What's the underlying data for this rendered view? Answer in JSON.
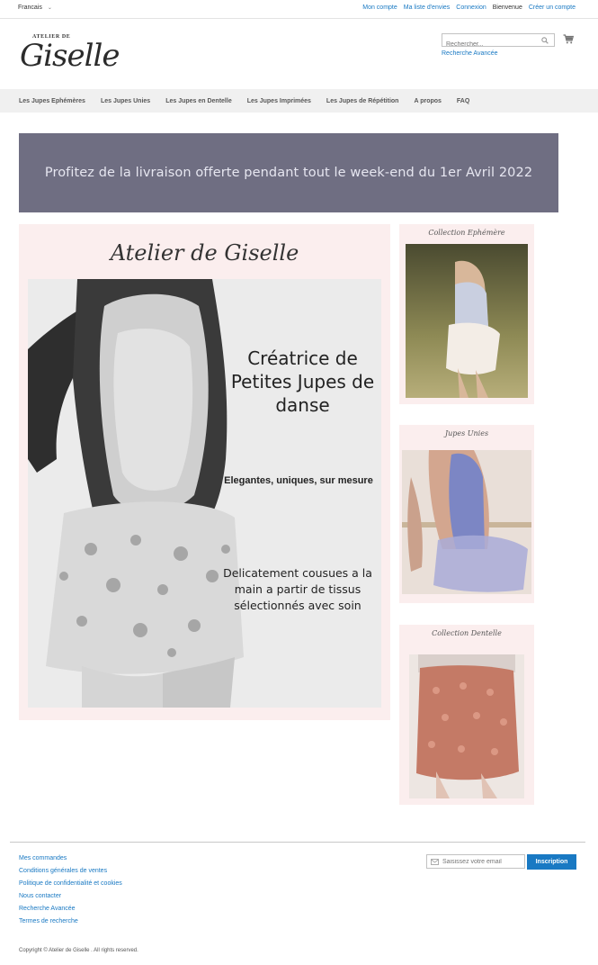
{
  "topbar": {
    "language": "Francais",
    "links": [
      "Mon compte",
      "Ma liste d'envies",
      "Connexion"
    ],
    "welcome": "Bienvenue",
    "create_account": "Créer un compte"
  },
  "header": {
    "logo_small": "ATELIER DE",
    "logo_big": "Giselle",
    "search_placeholder": "Rechercher...",
    "advanced_search": "Recherche Avancée"
  },
  "nav": {
    "items": [
      "Les Jupes Ephémères",
      "Les Jupes Unies",
      "Les Jupes en Dentelle",
      "Les Jupes Imprimées",
      "Les Jupes de Répétition",
      "A propos",
      "FAQ"
    ]
  },
  "banner": {
    "text": "Profitez de la livraison offerte pendant tout le week-end du 1er Avril 2022"
  },
  "hero": {
    "title": "Atelier de Giselle",
    "headline": "Créatrice de Petites Jupes de danse",
    "tagline": "Elegantes, uniques, sur mesure",
    "description": "Delicatement cousues a la main  a partir de tissus sélectionnés avec soin"
  },
  "cards": [
    {
      "title": "Collection Ephémère"
    },
    {
      "title": "Jupes Unies"
    },
    {
      "title": "Collection Dentelle"
    }
  ],
  "footer": {
    "links": [
      "Mes commandes",
      "Conditions générales de ventes",
      "Politique de confidentialité et cookies",
      "Nous contacter",
      "Recherche Avancée",
      "Termes de recherche"
    ],
    "newsletter_placeholder": "Saisissez votre email",
    "subscribe_label": "Inscription",
    "copyright": "Copyright © Atelier de Giselle . All rights reserved."
  },
  "colors": {
    "link": "#1979c3",
    "banner_bg": "#6f6e82",
    "card_bg": "#fbeeee",
    "nav_bg": "#f0f0f0"
  }
}
